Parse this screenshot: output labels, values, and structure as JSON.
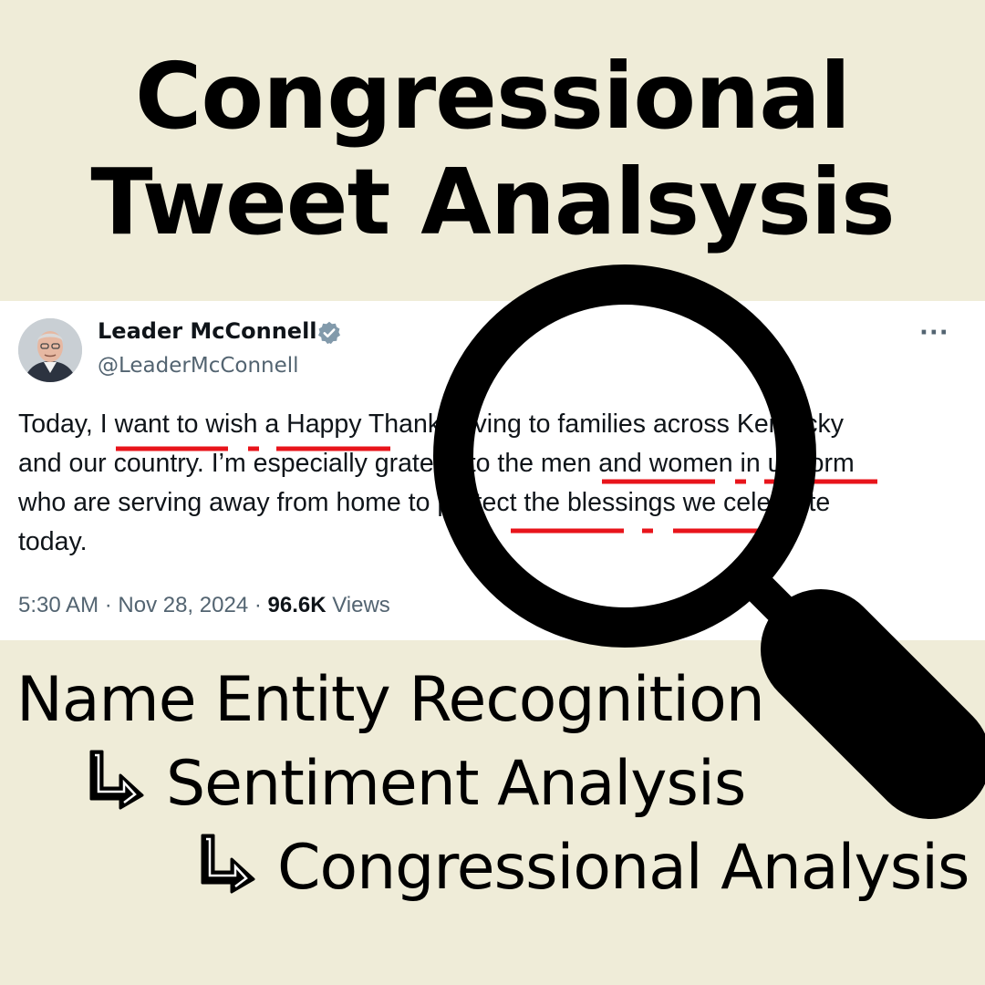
{
  "title": {
    "line1": "Congressional",
    "line2": "Tweet Analsysis"
  },
  "tweet": {
    "display_name": "Leader McConnell",
    "handle": "@LeaderMcConnell",
    "text_lines": [
      "Today, I want to wish a Happy Thanksgiving to families across Kentucky",
      "and our country. I’m especially grateful to the men and women in uniform",
      "who are serving away from home to protect the blessings we celebrate",
      "today."
    ],
    "time": "5:30 AM",
    "date": "Nov 28, 2024",
    "separator": " · ",
    "views_count": "96.6K",
    "views_label": "Views",
    "more_label": "···",
    "verified_color": "#829aab",
    "underline_color": "#e8141b"
  },
  "pipeline": {
    "step1": "Name Entity Recognition",
    "step2": "Sentiment Analysis",
    "step3": "Congressional Analysis"
  },
  "icons": {
    "magnifier": "magnifying-glass-icon",
    "arrow": "down-right-arrow-icon",
    "verified": "verified-badge-icon"
  }
}
